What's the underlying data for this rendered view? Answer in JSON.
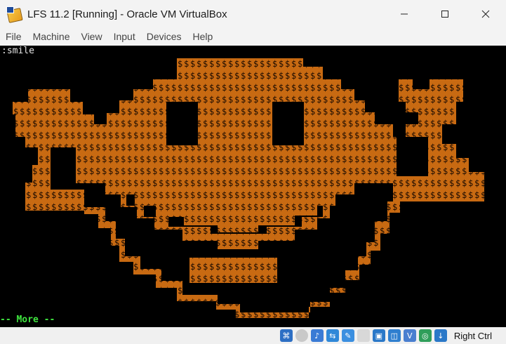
{
  "window": {
    "title": "LFS 11.2 [Running] - Oracle VM VirtualBox",
    "app_icon": "virtualbox-icon"
  },
  "menu": {
    "items": [
      "File",
      "Machine",
      "View",
      "Input",
      "Devices",
      "Help"
    ]
  },
  "console": {
    "command": ":smile",
    "pager_status": "-- More --",
    "art": {
      "glyphs": [
        "$",
        "o",
        "\""
      ],
      "fill_color": "#c86a12",
      "text_color": "#000000",
      "highlight_color": "#ffffff"
    }
  },
  "statusbar": {
    "icons": [
      "hard-disk-icon",
      "optical-disk-icon",
      "audio-icon",
      "network-icon",
      "usb-icon",
      "shared-folder-icon",
      "display-icon",
      "recording-icon",
      "virtualization-icon",
      "cpu-icon",
      "mouse-integration-icon"
    ],
    "host_key": "Right Ctrl"
  },
  "colors": {
    "console_bg": "#000000",
    "pager_green": "#3fe33f",
    "chrome_bg": "#f3f3f3"
  }
}
